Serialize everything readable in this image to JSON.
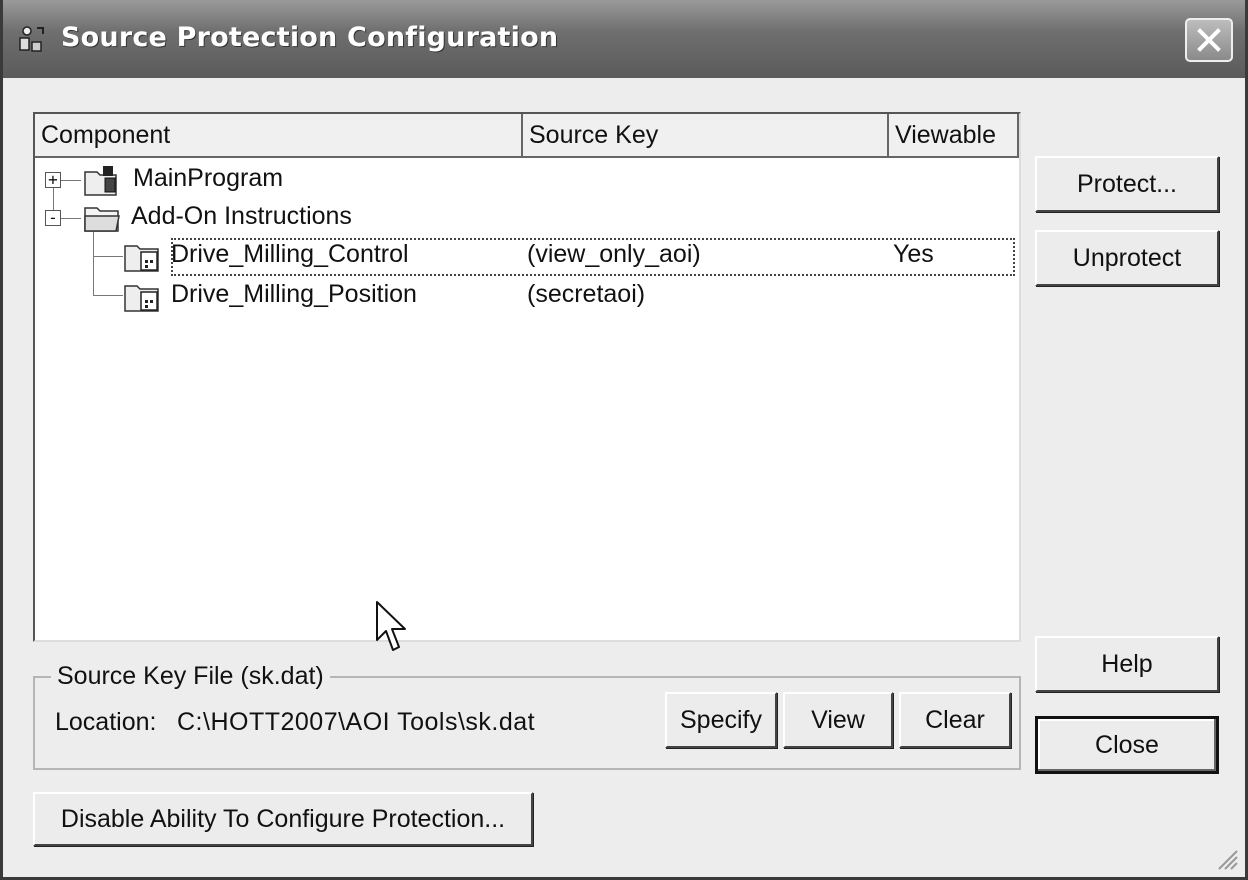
{
  "window": {
    "title": "Source Protection Configuration",
    "title_icon": "source-protection-icon",
    "close_icon": "close-icon"
  },
  "list": {
    "columns": [
      "Component",
      "Source Key",
      "Viewable"
    ],
    "rows": [
      {
        "component": "MainProgram",
        "source_key": "",
        "viewable": "",
        "expander": "+",
        "icon": "program-icon"
      },
      {
        "component": "Add-On Instructions",
        "source_key": "",
        "viewable": "",
        "expander": "-",
        "icon": "folder-icon"
      },
      {
        "component": "Drive_Milling_Control",
        "source_key": "(view_only_aoi)",
        "viewable": "Yes",
        "icon": "aoi-icon",
        "selected": true
      },
      {
        "component": "Drive_Milling_Position",
        "source_key": "(secretaoi)",
        "viewable": "",
        "icon": "aoi-icon"
      }
    ]
  },
  "side_buttons": {
    "protect": "Protect...",
    "unprotect": "Unprotect",
    "help": "Help",
    "close": "Close"
  },
  "source_key_file": {
    "legend": "Source Key File (sk.dat)",
    "location_label": "Location:",
    "location_value": "C:\\HOTT2007\\AOI  Tools\\sk.dat",
    "specify": "Specify",
    "view": "View",
    "clear": "Clear"
  },
  "disable_button": "Disable Ability To Configure Protection..."
}
